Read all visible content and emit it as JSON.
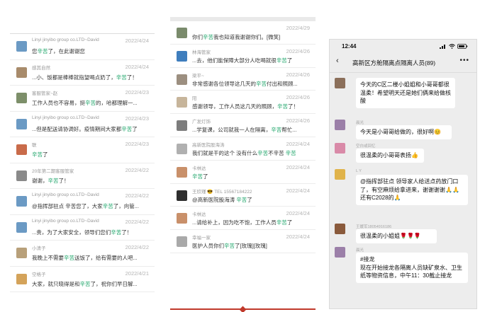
{
  "panel1": {
    "rows": [
      {
        "name": "Linyi jinyibo group co.LTD~David",
        "date": "2022/4/24",
        "pre": "您",
        "hl": "辛苦",
        "post": "了，在此谢谢您",
        "avatar": "#6b9ac4"
      },
      {
        "name": "感其自然",
        "date": "2022/4/24",
        "pre": "...小、饭都是棒棒就指望喝点奶了，",
        "hl": "辛苦",
        "post": "了！",
        "avatar": "#a88b6b"
      },
      {
        "name": "客服管家~赵",
        "date": "2022/4/23",
        "pre": "工作人员也不容易，挺",
        "hl": "辛苦",
        "post": "的，哈都理解一...",
        "avatar": "#7d8f6a"
      },
      {
        "name": "Linyi jinyibo group co.LTD~David",
        "date": "2022/4/23",
        "pre": "...但是配送请协调好。疫情期间大家都",
        "hl": "辛苦",
        "post": "了",
        "avatar": "#6b9ac4"
      },
      {
        "name": "联",
        "date": "2022/4/23",
        "pre": "",
        "hl": "辛苦",
        "post": "了",
        "avatar": "#c96b4a"
      },
      {
        "name": "20年第二期客服管家",
        "date": "2022/4/22",
        "pre": "谢谢，",
        "hl": "辛苦",
        "post": "了！",
        "avatar": "#8a8a8a"
      },
      {
        "name": "Linyi jinyibo group co.LTD~David",
        "date": "2022/4/22",
        "pre": "@指挥部驻点 辛苦您了，大家",
        "hl": "辛苦",
        "post": "了，向管...",
        "avatar": "#6b9ac4"
      },
      {
        "name": "Linyi jinyibo group co.LTD~David",
        "date": "2022/4/22",
        "pre": "...责，为了大家安全，领导们您们",
        "hl": "辛苦",
        "post": "了！",
        "avatar": "#6b9ac4"
      },
      {
        "name": "小清子",
        "date": "2022/4/22",
        "pre": "我晚上不需要",
        "hl": "辛苦",
        "post": "送饭了，给有需要的人吧...",
        "avatar": "#b8a07a"
      },
      {
        "name": "空格子",
        "date": "2022/4/21",
        "pre": "大家，就只晓得是和",
        "hl": "辛苦",
        "post": "了，祝你们早日解...",
        "avatar": "#d4a35a"
      }
    ]
  },
  "panel2": {
    "rows": [
      {
        "name": "",
        "date": "2022/4/29",
        "pre": "你们",
        "hl": "辛苦",
        "post": "我也知道我谢谢你们。[微笑]",
        "avatar": "#7a8b6c"
      },
      {
        "name": "林海管家",
        "date": "2022/4/26",
        "pre": "...去，他们能保障大部分人吃喝就很",
        "hl": "辛苦",
        "post": "了",
        "avatar": "#3f7ebd"
      },
      {
        "name": "梁平~",
        "date": "2022/4/26",
        "pre": "非常感谢各位领导这几天的",
        "hl": "辛苦",
        "post": "付出和照顾...",
        "avatar": "#9c8f80"
      },
      {
        "name": "阳",
        "date": "2022/4/26",
        "pre": "感谢领导，工作人员这几天的照顾，",
        "hl": "辛苦",
        "post": "了！",
        "avatar": "#c7b59b"
      },
      {
        "name": "广发灯饰",
        "date": "2022/4/26",
        "pre": "...学复课，公司就我一人在隔离，",
        "hl": "辛苦",
        "post": "帮忙...",
        "avatar": "#7d7d7d"
      },
      {
        "name": "高新医院股海涛",
        "date": "2022/4/24",
        "pre": "我们就是干的这个 没有什么",
        "hl": "辛苦",
        "post": "不辛苦",
        "post2": " 辛苦",
        "avatar": "#b0b0b0"
      },
      {
        "name": "卡林达",
        "date": "2022/4/24",
        "pre": "",
        "hl": "辛苦",
        "post": "了",
        "avatar": "#c9906a"
      },
      {
        "name": "王欣瑾 😎 TEL 15567184222",
        "date": "2022/4/24",
        "pre": "@高新医院股海涛 ",
        "hl": "辛苦",
        "post": "了",
        "avatar": "#2e2e2e"
      },
      {
        "name": "卡林达",
        "date": "2022/4/24",
        "pre": "...请给补上，因为吃不饱，工作人员",
        "hl": "辛苦",
        "post": "了",
        "avatar": "#c9906a"
      },
      {
        "name": "幸福一家",
        "date": "2022/4/24",
        "pre": "医护人员你们",
        "hl": "辛苦",
        "post": "了[玫瑰][玫瑰]",
        "avatar": "#a9a9a9"
      }
    ]
  },
  "phone": {
    "time": "12:44",
    "title": "高新区方舱隔离点隔离人员(89)",
    "messages": [
      {
        "name": "",
        "text": "今天的C区二楼小姐姐和小哥哥都很温柔！希望明天还是她们俩来给做核酸",
        "avatar": "#8b6f5a"
      },
      {
        "name": "晨光",
        "text": "今天是小哥哥给做的，很好啊😊",
        "avatar": "#9b7fa8"
      },
      {
        "name": "空白或回忆",
        "text": "很温柔的小哥哥表扬👍",
        "avatar": "#d98aa8"
      },
      {
        "name": "L Y",
        "text": "@指挥部驻点 领导家人给送点药放门口了，有空麻烦给拿进来，谢谢谢谢🙏🙏还有C2028的🙏",
        "avatar": "#e0b34a"
      },
      {
        "name": "王媛军18054916186",
        "text": "很温柔的小姐姐🌹🌹🌹",
        "avatar": "#8a5a3c"
      },
      {
        "name": "晨光",
        "text": "#接龙\n现在开始接龙各隔离人员缺矿泉水、卫生纸等物资信息，中午11：30截止接龙",
        "avatar": "#9b7fa8"
      }
    ]
  }
}
